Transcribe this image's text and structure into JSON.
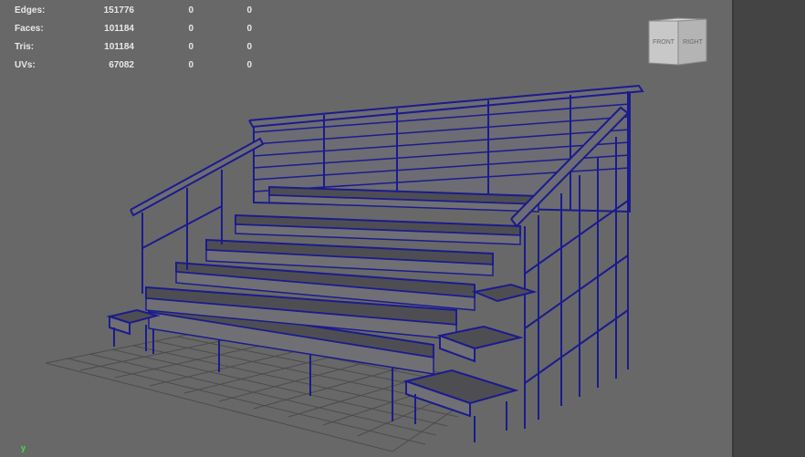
{
  "hud": {
    "rows": [
      {
        "label": "Edges:",
        "v1": "151776",
        "v2": "0",
        "v3": "0"
      },
      {
        "label": "Faces:",
        "v1": "101184",
        "v2": "0",
        "v3": "0"
      },
      {
        "label": "Tris:",
        "v1": "101184",
        "v2": "0",
        "v3": "0"
      },
      {
        "label": "UVs:",
        "v1": "67082",
        "v2": "0",
        "v3": "0"
      }
    ]
  },
  "viewcube": {
    "front_label": "FRONT",
    "right_label": "RIGHT"
  },
  "axis": {
    "y_label": "y",
    "y_color": "#3fe43f"
  },
  "colors": {
    "viewport_bg": "#686868",
    "wireframe": "#1a1a8c",
    "grid": "#4a4a4a",
    "hud_text": "#e8e8e8"
  },
  "model": {
    "name": "bleachers-wireframe"
  }
}
